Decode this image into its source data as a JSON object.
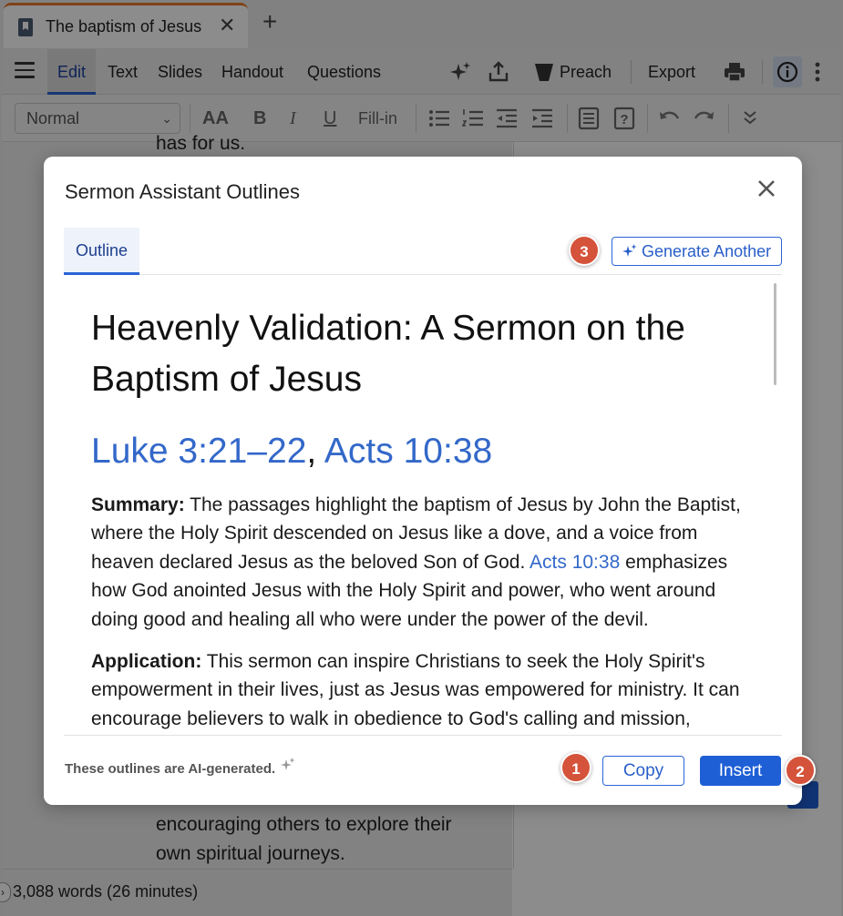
{
  "browser": {
    "tab_title": "The baptism of Jesus",
    "new_tab": "+",
    "close": "✕",
    "accent_color": "#e8782a"
  },
  "menubar": {
    "items": [
      "Edit",
      "Text",
      "Slides",
      "Handout",
      "Questions"
    ],
    "active": "Edit",
    "preach_label": "Preach",
    "export_label": "Export"
  },
  "formatbar": {
    "style_value": "Normal",
    "bold": "B",
    "italic": "I",
    "underline": "U",
    "fillin": "Fill-in",
    "fontsize_glyph": "AA"
  },
  "document": {
    "top_line": "has for us.",
    "bottom_lines": [
      "encouraging others to explore their",
      "own spiritual journeys."
    ],
    "wordcount": "3,088 words (26 minutes)"
  },
  "modal": {
    "title": "Sermon Assistant Outlines",
    "tab_label": "Outline",
    "generate_label": "Generate Another",
    "heading": "Heavenly Validation: A Sermon on the Baptism of Jesus",
    "refs": [
      "Luke 3:21–22",
      "Acts 10:38"
    ],
    "separator": ",",
    "summary_label": "Summary:",
    "summary_part1": " The passages highlight the baptism of Jesus by John the Baptist, where the Holy Spirit descended on Jesus like a dove, and a voice from heaven declared Jesus as the beloved Son of God. ",
    "summary_link": "Acts 10:38",
    "summary_part2": " emphasizes how God anointed Jesus with the Holy Spirit and power, who went around doing good and healing all who were under the power of the devil.",
    "application_label": "Application:",
    "application_text": " This sermon can inspire Christians to seek the Holy Spirit's empowerment in their lives, just as Jesus was empowered for ministry. It can encourage believers to walk in obedience to God's calling and mission,",
    "footer_note": "These outlines are AI-generated.",
    "copy_label": "Copy",
    "insert_label": "Insert",
    "badges": [
      "1",
      "2",
      "3"
    ]
  },
  "colors": {
    "primary": "#1f5fd6",
    "link": "#3368c9",
    "badge": "#d4533a"
  },
  "icons": [
    "ai-sparkle-icon",
    "share-icon",
    "pulpit-icon",
    "print-icon",
    "info-icon",
    "more-icon",
    "list-icon",
    "numbered-list-icon",
    "outdent-icon",
    "indent-icon",
    "page-icon",
    "question-icon",
    "undo-icon",
    "redo-icon",
    "collapse-icon",
    "close-icon"
  ]
}
